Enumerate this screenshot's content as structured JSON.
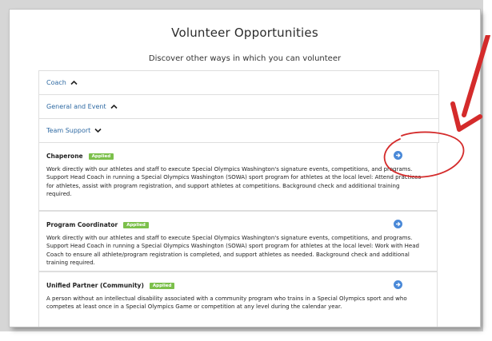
{
  "page": {
    "title": "Volunteer Opportunities",
    "subtitle": "Discover other ways in which you can volunteer"
  },
  "accordion": [
    {
      "label": "Coach",
      "state": "expanded-up"
    },
    {
      "label": "General and Event",
      "state": "expanded-up"
    },
    {
      "label": "Team Support",
      "state": "collapsed-down"
    }
  ],
  "opportunities": [
    {
      "title": "Chaperone",
      "badge": "Applied",
      "description": "Work directly with our athletes and staff to execute Special Olympics Washington's signature events, competitions, and programs. Support Head Coach in running a Special Olympics Washington (SOWA) sport program for athletes at the local level: Attend practices for athletes, assist with program registration, and support athletes at competitions. Background check and additional training required."
    },
    {
      "title": "Program Coordinator",
      "badge": "Applied",
      "description": "Work directly with our athletes and staff to execute Special Olympics Washington's signature events, competitions, and programs. Support Head Coach in running a Special Olympics Washington (SOWA) sport program for athletes at the local level: Work with Head Coach to ensure all athlete/program registration is completed, and support athletes as needed. Background check and additional training required."
    },
    {
      "title": "Unified Partner (Community)",
      "badge": "Applied",
      "description": "A person without an intellectual disability associated with a community program who trains in a Special Olympics sport and who competes at least once in a Special Olympics Game or competition at any level during the calendar year."
    }
  ],
  "colors": {
    "link_blue": "#2f6aa3",
    "badge_green": "#7cc04b",
    "icon_blue": "#4a89d8",
    "annotation_red": "#d42b2b"
  },
  "icons": {
    "accordion_up": "chevron-up-icon",
    "accordion_down": "chevron-down-icon",
    "item_action": "arrow-right-circle-icon"
  }
}
